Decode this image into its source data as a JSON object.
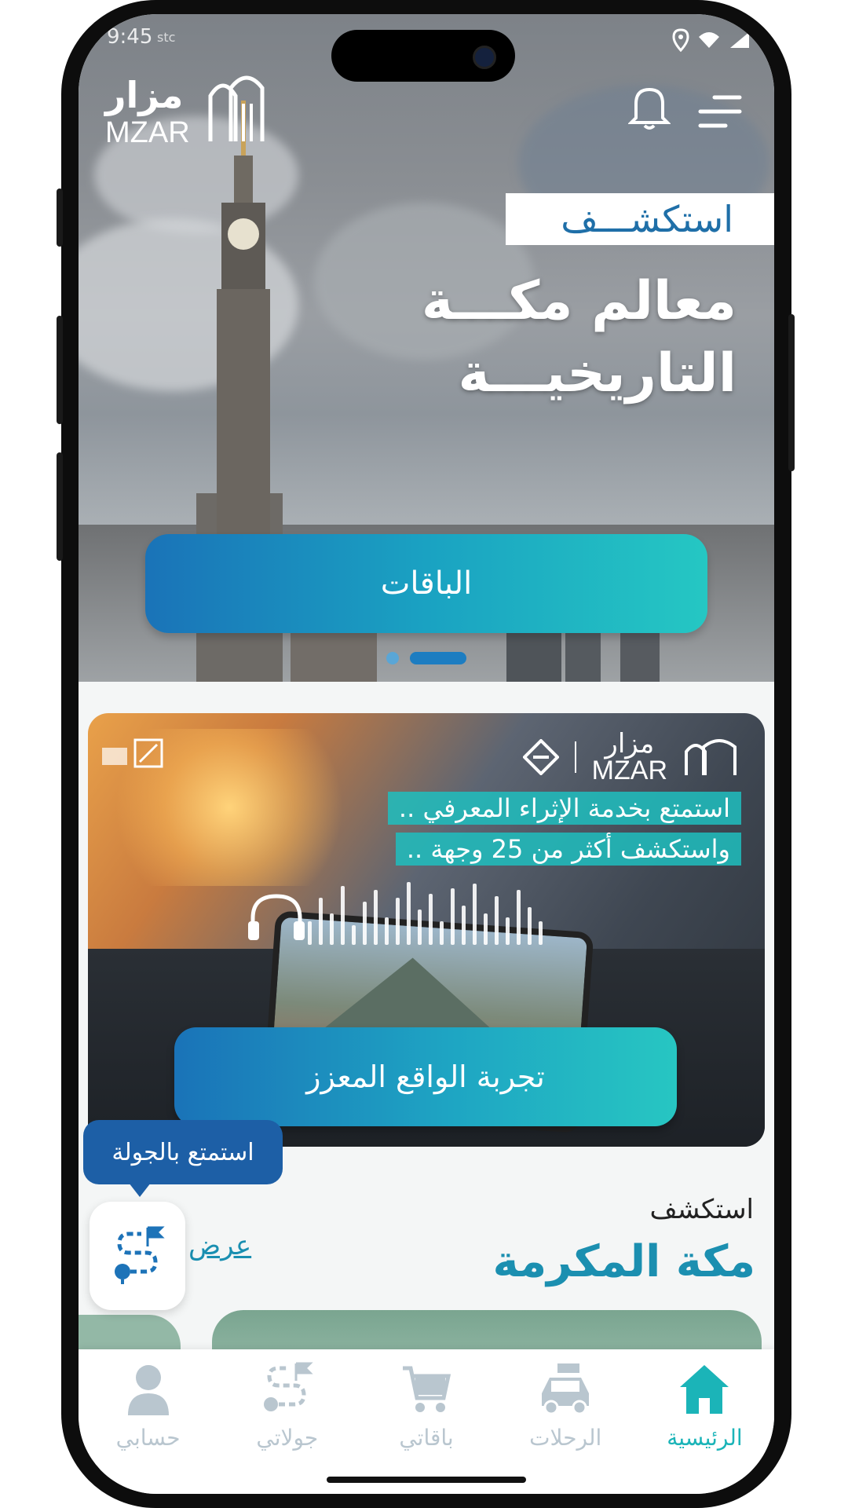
{
  "status_bar": {
    "time": "9:45",
    "carrier": "stc"
  },
  "header": {
    "logo_ar": "مزار",
    "logo_en": "MZAR"
  },
  "hero": {
    "explore_label": "استكشـــف",
    "title_line1": "معالم مكـــة",
    "title_line2": "التاريخيـــة",
    "packages_button": "الباقات",
    "carousel": {
      "count": 2,
      "active_index": 1
    }
  },
  "banner": {
    "logo_ar": "مزار",
    "logo_en": "MZAR",
    "line1": "استمتع بخدمة الإثراء المعرفي ..",
    "line2": "واستكشف أكثر من 25 وجهة ..",
    "vr_button": "تجربة الواقع المعزز"
  },
  "tour": {
    "tooltip": "استمتع بالجولة"
  },
  "section": {
    "subtitle": "استكشف",
    "title": "مكة المكرمة",
    "view_all": "عرض"
  },
  "bottom_nav": {
    "items": [
      {
        "label": "حسابي",
        "icon": "person-icon"
      },
      {
        "label": "جولاتي",
        "icon": "route-icon"
      },
      {
        "label": "باقاتي",
        "icon": "cart-icon"
      },
      {
        "label": "الرحلات",
        "icon": "car-icon"
      },
      {
        "label": "الرئيسية",
        "icon": "home-icon"
      }
    ],
    "active": "الرئيسية"
  },
  "colors": {
    "accent": "#1bb4b8",
    "primary": "#1d73b8",
    "title": "#1b8fb0"
  }
}
